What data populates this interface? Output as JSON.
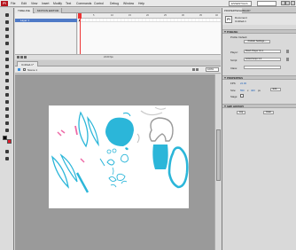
{
  "app": {
    "logo": "Fl",
    "menu": [
      "File",
      "Edit",
      "View",
      "Insert",
      "Modify",
      "Text",
      "Commands",
      "Control",
      "Debug",
      "Window",
      "Help"
    ],
    "workspace": "ESSENTIALS"
  },
  "timeline": {
    "tabs": [
      "TIMELINE",
      "MOTION EDITOR"
    ],
    "layer_name": "Layer 1",
    "frame_numbers": [
      "5",
      "10",
      "15",
      "20",
      "25",
      "30",
      "35",
      "40"
    ],
    "fps": "24.00 fps"
  },
  "stage": {
    "document_tab": "Untitled-1*",
    "scene": "Scene 1",
    "zoom": "100%"
  },
  "right_panel": {
    "tabs": [
      "PROPERTIES",
      "LIBRARY"
    ],
    "doc_icon": "Fl",
    "doc_type": "Document",
    "doc_name": "Untitled-1",
    "publish_section": "PUBLISH",
    "profile_label": "Profile: Default",
    "publish_settings": "Publish Settings...",
    "player_label": "Player:",
    "player_value": "Flash Player 10.1",
    "script_label": "Script:",
    "script_value": "ActionScript 3.0",
    "class_label": "Class:",
    "properties_section": "PROPERTIES",
    "fps_label": "FPS:",
    "fps_value": "24.00",
    "size_label": "Size:",
    "size_w": "550",
    "size_x": "x",
    "size_h": "400",
    "size_unit": "px",
    "edit_label": "Edit...",
    "stage_label": "Stage:",
    "swf_section": "SWF HISTORY",
    "log_button": "Log",
    "clear_button": "Clear"
  },
  "colors": {
    "stroke_swatch": "#000000",
    "fill_swatch": "#e21b2b",
    "drawing_blue": "#2bb6d9",
    "drawing_pink": "#ee6aa7"
  }
}
